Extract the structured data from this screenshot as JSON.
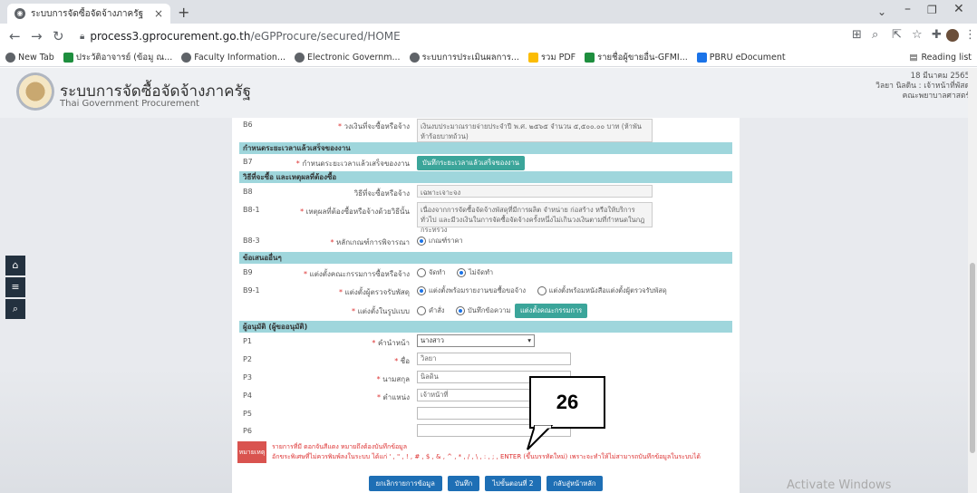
{
  "browser": {
    "tab_title": "ระบบการจัดซื้อจัดจ้างภาครัฐ",
    "tab_close": "×",
    "new_tab": "+",
    "url_host": "process3.gprocurement.go.th",
    "url_path": "/eGPProcure/secured/HOME",
    "bookmarks": [
      {
        "icon": "c",
        "label": "New Tab"
      },
      {
        "icon": "g",
        "label": "ประวัติอาจารย์ (ข้อมู ณ..."
      },
      {
        "icon": "c",
        "label": "Faculty Information..."
      },
      {
        "icon": "c",
        "label": "Electronic Governm..."
      },
      {
        "icon": "c",
        "label": "ระบบการประเมินผลการ..."
      },
      {
        "icon": "y",
        "label": "รวม PDF"
      },
      {
        "icon": "g",
        "label": "รายชื่อผู้ขายอื่น-GFMI..."
      },
      {
        "icon": "b",
        "label": "PBRU eDocument"
      }
    ],
    "reading_list": "Reading list"
  },
  "header": {
    "title": "ระบบการจัดซื้อจัดจ้างภาครัฐ",
    "subtitle": "Thai Government Procurement",
    "user_line1": "18 มีนาคม 2565",
    "user_line2": "วิลยา นิลดิน : เจ้าหน้าที่พัสดุ",
    "user_line3": "คณะพยาบาลศาสตร์"
  },
  "form": {
    "b6": {
      "code": "B6",
      "label": "วงเงินที่จะซื้อหรือจ้าง",
      "value": "เงินงบประมาณรายจ่ายประจำปี พ.ศ. ๒๕๖๕ จำนวน ๕,๕๐๐.๐๐ บาท (ห้าพันห้าร้อยบาทถ้วน)"
    },
    "sec_deadline": "กำหนดระยะเวลาแล้วเสร็จของงาน",
    "b7": {
      "code": "B7",
      "label": "กำหนดระยะเวลาแล้วเสร็จของงาน",
      "button": "บันทึกระยะเวลาแล้วเสร็จของงาน"
    },
    "sec_method": "วิธีที่จะซื้อ และเหตุผลที่ต้องซื้อ",
    "b8": {
      "code": "B8",
      "label": "วิธีที่จะซื้อหรือจ้าง",
      "value": "เฉพาะเจาะจง"
    },
    "b81": {
      "code": "B8-1",
      "label": "เหตุผลที่ต้องซื้อหรือจ้างด้วยวิธีนั้น",
      "value": "เนื่องจากการจัดซื้อจัดจ้างพัสดุที่มีการผลิต จำหน่าย ก่อสร้าง หรือให้บริการทั่วไป และมีวงเงินในการจัดซื้อจัดจ้างครั้งหนึ่งไม่เกินวงเงินตามที่กำหนดในกฎกระทรวง"
    },
    "b83": {
      "code": "B8-3",
      "label": "หลักเกณฑ์การพิจารณา",
      "option": "เกณฑ์ราคา"
    },
    "sec_other": "ข้อเสนออื่นๆ",
    "b9": {
      "code": "B9",
      "label": "แต่งตั้งคณะกรรมการซื้อหรือจ้าง",
      "opt1": "จัดทำ",
      "opt2": "ไม่จัดทำ"
    },
    "b91": {
      "code": "B9-1",
      "label": "แต่งตั้งผู้ตรวจรับพัสดุ",
      "opt1": "แต่งตั้งพร้อมรายงานขอซื้อขอจ้าง",
      "opt2": "แต่งตั้งพร้อมหนังสือแต่งตั้งผู้ตรวจรับพัสดุ"
    },
    "b92": {
      "label": "แต่งตั้งในรูปแบบ",
      "opt1": "คำสั่ง",
      "opt2": "บันทึกข้อความ",
      "button": "แต่งตั้งคณะกรรมการ"
    },
    "sec_approver": "ผู้อนุมัติ (ผู้ขออนุมัติ)",
    "p1": {
      "code": "P1",
      "label": "คำนำหน้า",
      "value": "นางสาว",
      "arrow": "▾"
    },
    "p2": {
      "code": "P2",
      "label": "ชื่อ",
      "value": "วิลยา"
    },
    "p3": {
      "code": "P3",
      "label": "นามสกุล",
      "value": "นิลดิน"
    },
    "p4": {
      "code": "P4",
      "label": "ตำแหน่ง",
      "value": "เจ้าหน้าที่"
    },
    "p5": {
      "code": "P5"
    },
    "p6": {
      "code": "P6"
    },
    "notes_badge": "หมายเหตุ",
    "notes_line1": "รายการที่มี ดอกจันสีแดง หมายถึงต้องบันทึกข้อมูล",
    "notes_line2": "อักขระพิเศษที่ไม่ควรพิมพ์ลงในระบบ ได้แก่ ' , \" , ! , # , $ , & , ^ , * , / , \\ , : , ; , ENTER (ขึ้นบรรทัดใหม่) เพราะจะทำให้ไม่สามารถบันทึกข้อมูลในระบบได้",
    "actions": [
      "ยกเลิกรายการข้อมูล",
      "บันทึก",
      "ไปขั้นตอนที่ 2",
      "กลับสู่หน้าหลัก"
    ]
  },
  "annotation": "26",
  "watermark": "Activate Windows"
}
